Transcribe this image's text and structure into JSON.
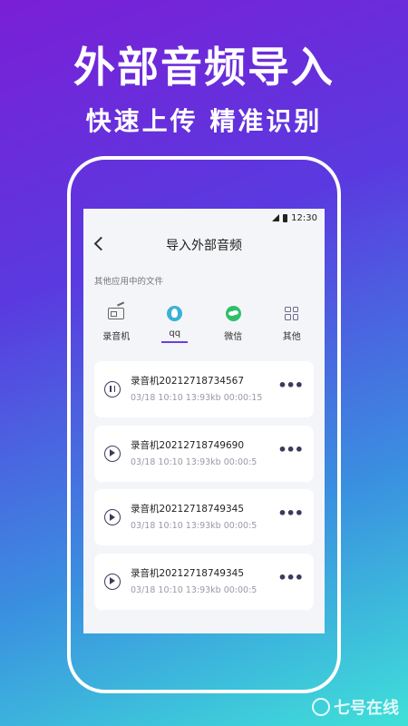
{
  "promo": {
    "headline": "外部音频导入",
    "subline": "快速上传 精准识别"
  },
  "status_bar": {
    "time": "12:30"
  },
  "header": {
    "title": "导入外部音频"
  },
  "section": {
    "label": "其他应用中的文件"
  },
  "apps": [
    {
      "label": "录音机",
      "icon": "radio-icon"
    },
    {
      "label": "qq",
      "icon": "qq-icon",
      "active": true
    },
    {
      "label": "微信",
      "icon": "wechat-icon"
    },
    {
      "label": "其他",
      "icon": "grid-icon"
    }
  ],
  "files": [
    {
      "name": "录音机20212718734567",
      "meta": "03/18 10:10   13:93kb 00:00:15",
      "state": "paused"
    },
    {
      "name": "录音机20212718749690",
      "meta": "03/18 10:10   13:93kb 00:00:5",
      "state": "play"
    },
    {
      "name": "录音机20212718749345",
      "meta": "03/18 10:10   13:93kb 00:00:5",
      "state": "play"
    },
    {
      "name": "录音机20212718749345",
      "meta": "03/18 10:10   13:93kb 00:00:5",
      "state": "play"
    }
  ],
  "more_label": "•••",
  "watermark": {
    "text": "七号在线"
  }
}
